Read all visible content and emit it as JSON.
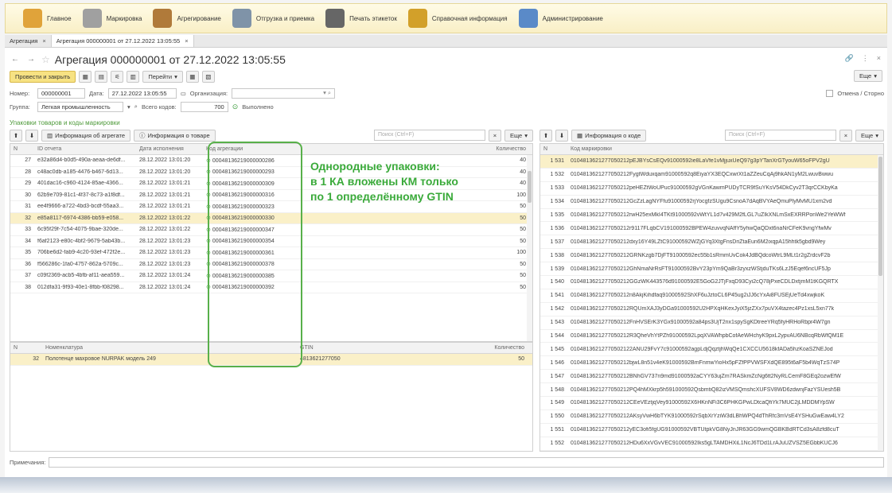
{
  "menu": [
    {
      "label": "Главное",
      "icon": "home-icon",
      "color": "#e0a33a"
    },
    {
      "label": "Маркировка",
      "icon": "marking-doc-icon",
      "color": "#a0a0a0"
    },
    {
      "label": "Агрегирование",
      "icon": "box-icon",
      "color": "#b07a3a"
    },
    {
      "label": "Отгрузка и приемка",
      "icon": "truck-icon",
      "color": "#7f93a8"
    },
    {
      "label": "Печать этикеток",
      "icon": "printer-icon",
      "color": "#666666"
    },
    {
      "label": "Справочная информация",
      "icon": "books-icon",
      "color": "#d2a02a"
    },
    {
      "label": "Администрирование",
      "icon": "admin-icon",
      "color": "#5a8ac8"
    }
  ],
  "tabs": [
    {
      "label": "Агрегация"
    },
    {
      "label": "Агрегация 000000001 от 27.12.2022 13:05:55"
    }
  ],
  "doc": {
    "title": "Агрегация 000000001 от 27.12.2022 13:05:55"
  },
  "cmd": {
    "post_close": "Провести и закрыть",
    "goto": "Перейти",
    "more": "Еще"
  },
  "fields": {
    "number_label": "Номер:",
    "number": "000000001",
    "date_label": "Дата:",
    "date": "27.12.2022 13:05:55",
    "org_label": "Организация:",
    "org": "",
    "storno": "Отмена / Сторно",
    "group_label": "Группа:",
    "group": "Легкая промышленность",
    "codes_label": "Всего кодов:",
    "codes": "700",
    "status": "Выполнено"
  },
  "section_title": "Упаковки товаров и коды маркировки",
  "left": {
    "btn_aggr": "Информация об агрегате",
    "btn_goods": "Информация о товаре",
    "search": "Поиск (Ctrl+F)",
    "more": "Еще",
    "headers": [
      "N",
      "ID отчета",
      "Дата исполнения",
      "Код агрегации",
      "Количество"
    ],
    "rows": [
      {
        "n": "27",
        "id": "e32a86d4-b0d5-490a-aeaa-de6df...",
        "date": "28.12.2022 13:01:20",
        "code": "00048136219000000286",
        "qty": "40"
      },
      {
        "n": "28",
        "id": "c48ac0db-a185-4476-b467-6d13...",
        "date": "28.12.2022 13:01:20",
        "code": "00048136219000000293",
        "qty": "40"
      },
      {
        "n": "29",
        "id": "401dac16-c960-4124-85ae-4366...",
        "date": "28.12.2022 13:01:21",
        "code": "00048136219000000309",
        "qty": "40"
      },
      {
        "n": "30",
        "id": "62b9e709-81c1-4f37-8c73-a1f8df...",
        "date": "28.12.2022 13:01:21",
        "code": "00048136219000000316",
        "qty": "100"
      },
      {
        "n": "31",
        "id": "ee4f9666-a722-4bd3-bcdf-55aa3...",
        "date": "28.12.2022 13:01:21",
        "code": "00048136219000000323",
        "qty": "50"
      },
      {
        "n": "32",
        "id": "e85a8117-6974-4386-bb59-e058...",
        "date": "28.12.2022 13:01:22",
        "code": "00048136219000000330",
        "qty": "50"
      },
      {
        "n": "33",
        "id": "6c95f29f-7c54-4075-9bae-320de...",
        "date": "28.12.2022 13:01:22",
        "code": "00048136219000000347",
        "qty": "50"
      },
      {
        "n": "34",
        "id": "f6af2123-e80c-4bf2-9679-5ab43b...",
        "date": "28.12.2022 13:01:23",
        "code": "00048136219000000354",
        "qty": "50"
      },
      {
        "n": "35",
        "id": "706be6d2-fab9-4c20-93ef-472f2e...",
        "date": "28.12.2022 13:01:23",
        "code": "00048136219000000361",
        "qty": "100"
      },
      {
        "n": "36",
        "id": "f566286c-1fa0-4757-862a-5709c...",
        "date": "28.12.2022 13:01:23",
        "code": "00048136219000000378",
        "qty": "50"
      },
      {
        "n": "37",
        "id": "c09f2369-acb5-4bfb-af11-aea559...",
        "date": "28.12.2022 13:01:24",
        "code": "00048136219000000385",
        "qty": "50"
      },
      {
        "n": "38",
        "id": "012dfa31-9f93-40e1-8fbb-f08298...",
        "date": "28.12.2022 13:01:24",
        "code": "00048136219000000392",
        "qty": "50"
      }
    ]
  },
  "bottom": {
    "headers": [
      "N",
      "Номенклатура",
      "GTIN",
      "Количество"
    ],
    "rows": [
      {
        "n": "32",
        "name": "Полотенце махровое NURPAK модель 249",
        "gtin": "4813621277050",
        "qty": "50"
      }
    ]
  },
  "right": {
    "btn_code": "Информация о коде",
    "search": "Поиск (Ctrl+F)",
    "more": "Еще",
    "headers": [
      "N",
      "Код маркировки"
    ],
    "rows": [
      {
        "n": "1 531",
        "code": "0104813621277050212pEJBYsCsEQv91000592ie8LaVfe1vMjjuxUeQ97g3pYTanXrGTyouW65oFPV2gU"
      },
      {
        "n": "1 532",
        "code": "0104813621277050212FygtWduxqam91000592q8EiyaYX3EQCxwrXt1aZZeuCqAj9hkAN1yM2LwuvBwwu"
      },
      {
        "n": "1 533",
        "code": "0104813621277050212peHEZtWoUPuc91000592gVGnKawmPUDyTCR9fSuYKsV54DkCyv2T3qrCCKbyKa"
      },
      {
        "n": "1 534",
        "code": "0104813621277050212GcZzLagNYFfu91000592rjYocgfzSUgu9CsnoA7dAqBVYAeQmuPlyMvMU1xm2vd"
      },
      {
        "n": "1 535",
        "code": "0104813621277050212rwH25exMkI4TKt91000592vWtYL1d7v429M2fLGL7uZIkXNLmSxEXRRPonWe2YeWWf"
      },
      {
        "n": "1 536",
        "code": "0104813621277050212r9117FLqbCV191000592BPEW4zuvvqNAffY5yhwQaQDxt6naNrCFeK9vngYfwMv"
      },
      {
        "n": "1 537",
        "code": "0104813621277050212dxy16Y49LZtC91000592WZjGYq3XtgFnsDriZtaEun6M2ixqpA15hhtk5gbd9Wey"
      },
      {
        "n": "1 538",
        "code": "0104813621277050212GRNKzgb7DjFT91000592ec55b1sRmmUvCok4JdBQdcoWtrL9MLt1r2gZrdcvF2b"
      },
      {
        "n": "1 539",
        "code": "0104813621277050212GhNmaNrRsFT91000592BvY23pYm9QaBr3zyxzWStjduTKs6LzJ5Eqef6ncUF5Jp"
      },
      {
        "n": "1 540",
        "code": "0104813621277050212GGzWK443576d91000592E5GoG2JTjFxqD93Cyi2cQ78jPxeCDLDxtjmM1tKGQRTX"
      },
      {
        "n": "1 541",
        "code": "0104813621277050212n8AkjKihdfaq91000592ShXF6uJztoCL6P45ug2iJJ6cYxAi8FUSEjUeTd4xwjkoK"
      },
      {
        "n": "1 542",
        "code": "0104813621277050212RQUmXAJ3yDGa91000592U2HPXqHKexJyiX5jzZXx7puVX4tazec4Pz1xsL5xn77k"
      },
      {
        "n": "1 543",
        "code": "0104813621277050212FnHVSErK3YGx91000592a84ps3UjT2nx1spySgKDtreeYRq5fyHRHoRbpr4W7gn"
      },
      {
        "n": "1 544",
        "code": "0104813621277050212R3QheVhYtPZh91000592LpqXVAWhpbCofAeWHchyK9pxL2ypvAU6NBcqRbWfQM1E"
      },
      {
        "n": "1 545",
        "code": "01048136212770502122ANU29FvY7c91000592agpLdjQqztjhWqQe1CXCCU5618kfADa5hzKoaSZNEJod"
      },
      {
        "n": "1 546",
        "code": "0104813621277050212bjwL8n51v4eK91000592BmFnmwYioHx5pFZfPPVWSFXdQE895t6aF5b4WqTzS74P"
      },
      {
        "n": "1 547",
        "code": "0104813621277050212BNhGV737n9md91000592aCYY63ujZm7RASkmZcNg6tt2NyRLCemF8GEq2ozwEfW"
      },
      {
        "n": "1 548",
        "code": "0104813621277050212PQ4hMXkrp5h591000592QsbmtiQ82izVMSQmshcXUFSV8WD6zdwnjFazYSUesh5B"
      },
      {
        "n": "1 549",
        "code": "0104813621277050212CEeVEztjqVey91000592X6HKnNFi3C6PHKGPwLDtcaQfiYk7MUC2jLMDDMYpSW"
      },
      {
        "n": "1 550",
        "code": "0104813621277050212AKsyVwH6bTYK91000592rSqbXrYziW3dLBhWPQ4dThRfc3mVsE4YSHuGwEaw4LY2"
      },
      {
        "n": "1 551",
        "code": "0104813621277050212yEC3ofi5fgUG91000592VBTUtpkVG8NyJnJR63GG9wmQGBKBdRTCd3sA8zfd8cuT"
      },
      {
        "n": "1 552",
        "code": "0104813621277050212HDu6XxVGvVEC91000592Iks5gLTAMDHXiL1NcJ6TDd1LrAJuUZVSZ5EGbbKUCJ6"
      }
    ]
  },
  "notes_label": "Примечания:",
  "annotation": {
    "line1": "Однородные упаковки:",
    "line2": "в 1 КА вложены КМ только",
    "line3": "по 1 определённому GTIN"
  }
}
